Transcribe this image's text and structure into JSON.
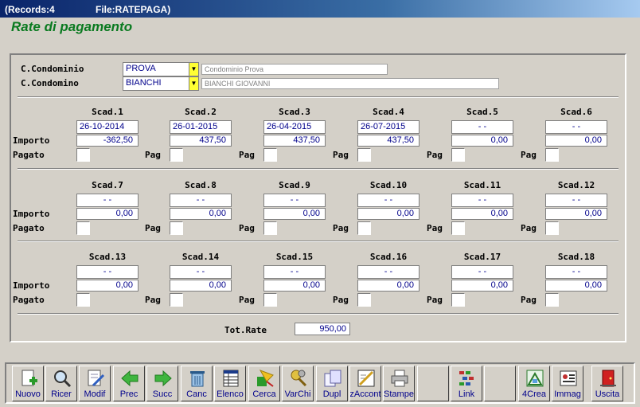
{
  "window": {
    "records": "(Records:4",
    "file": "File:RATEPAGA)"
  },
  "heading": "Rate di pagamento",
  "condominio": {
    "label": "C.Condominio",
    "code": "PROVA",
    "description": "Condominio Prova"
  },
  "condomino": {
    "label": "C.Condomino",
    "code": "BIANCHI",
    "description": "BIANCHI GIOVANNI"
  },
  "labels": {
    "importo": "Importo",
    "pagato": "Pagato",
    "pag": "Pag",
    "tot_rate": "Tot.Rate"
  },
  "groups": [
    [
      {
        "title": "Scad.1",
        "date": "26-10-2014",
        "amount": "-362,50"
      },
      {
        "title": "Scad.2",
        "date": "26-01-2015",
        "amount": "437,50"
      },
      {
        "title": "Scad.3",
        "date": "26-04-2015",
        "amount": "437,50"
      },
      {
        "title": "Scad.4",
        "date": "26-07-2015",
        "amount": "437,50"
      },
      {
        "title": "Scad.5",
        "date": "-    -",
        "amount": "0,00"
      },
      {
        "title": "Scad.6",
        "date": "-    -",
        "amount": "0,00"
      }
    ],
    [
      {
        "title": "Scad.7",
        "date": "-    -",
        "amount": "0,00"
      },
      {
        "title": "Scad.8",
        "date": "-    -",
        "amount": "0,00"
      },
      {
        "title": "Scad.9",
        "date": "-    -",
        "amount": "0,00"
      },
      {
        "title": "Scad.10",
        "date": "-    -",
        "amount": "0,00"
      },
      {
        "title": "Scad.11",
        "date": "-    -",
        "amount": "0,00"
      },
      {
        "title": "Scad.12",
        "date": "-    -",
        "amount": "0,00"
      }
    ],
    [
      {
        "title": "Scad.13",
        "date": "-    -",
        "amount": "0,00"
      },
      {
        "title": "Scad.14",
        "date": "-    -",
        "amount": "0,00"
      },
      {
        "title": "Scad.15",
        "date": "-    -",
        "amount": "0,00"
      },
      {
        "title": "Scad.16",
        "date": "-    -",
        "amount": "0,00"
      },
      {
        "title": "Scad.17",
        "date": "-    -",
        "amount": "0,00"
      },
      {
        "title": "Scad.18",
        "date": "-    -",
        "amount": "0,00"
      }
    ]
  ],
  "total": "950,00",
  "toolbar": [
    {
      "label": "Nuovo",
      "icon": "new-document-icon"
    },
    {
      "label": "Ricer",
      "icon": "search-icon"
    },
    {
      "label": "Modif",
      "icon": "edit-document-icon"
    },
    {
      "label": "Prec",
      "icon": "arrow-left-icon"
    },
    {
      "label": "Succ",
      "icon": "arrow-right-icon"
    },
    {
      "label": "Canc",
      "icon": "trash-icon"
    },
    {
      "label": "Elenco",
      "icon": "list-icon"
    },
    {
      "label": "Cerca",
      "icon": "find-icon"
    },
    {
      "label": "VarChi",
      "icon": "keys-icon"
    },
    {
      "label": "Dupl",
      "icon": "duplicate-icon"
    },
    {
      "label": "zAccont",
      "icon": "pencil-icon"
    },
    {
      "label": "Stampe",
      "icon": "printer-icon"
    },
    {
      "label": "",
      "icon": ""
    },
    {
      "label": "Link",
      "icon": "link-icon"
    },
    {
      "label": "",
      "icon": ""
    },
    {
      "label": "4Crea",
      "icon": "create-icon"
    },
    {
      "label": "Immag",
      "icon": "image-icon"
    },
    {
      "label": "Uscita",
      "icon": "exit-door-icon"
    }
  ],
  "colors": {
    "accent_green": "#0a7a20",
    "value_blue": "#00008b",
    "dropdown_yellow": "#ffff33"
  }
}
